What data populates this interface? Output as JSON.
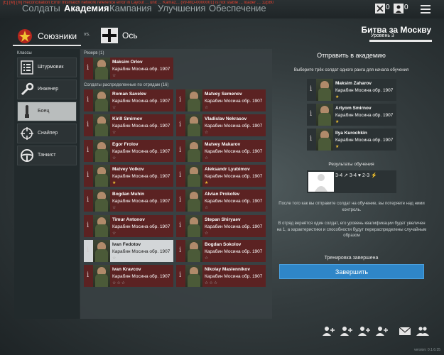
{
  "top_nav": {
    "tabs": [
      {
        "label": "Солдаты"
      },
      {
        "label": "Академия"
      },
      {
        "label": "Кампания"
      },
      {
        "label": "Улучшения"
      },
      {
        "label": "Обеспечение"
      }
    ],
    "debug_text": "[E] [M] [m] Reconciliation Error mismatch network reference error in Layout ... unit ... Kamaz... (v9-MD-0000001) is not stable ... loader ... 12p80",
    "counters": {
      "first": "0",
      "second": "0"
    }
  },
  "sides": {
    "allies": "Союзники",
    "vs": "vs.",
    "axis": "Ось"
  },
  "mission": {
    "title": "Битва за Москву",
    "level": "Уровень 3"
  },
  "classes": {
    "title": "Классы",
    "items": [
      {
        "label": "Штурмовик",
        "icon": "list-icon"
      },
      {
        "label": "Инженер",
        "icon": "wrench-icon"
      },
      {
        "label": "Боец",
        "icon": "bullet-icon"
      },
      {
        "label": "Снайпер",
        "icon": "crosshair-icon"
      },
      {
        "label": "Танкист",
        "icon": "steering-wheel-icon"
      }
    ]
  },
  "reserve": {
    "title": "Резерв (1)",
    "soldiers": [
      {
        "name": "Maksim Orlov",
        "weapon": "Карабин Мосина обр. 1907",
        "stars": "☆"
      }
    ]
  },
  "squads": {
    "title": "Солдаты распределенные по отрядам (16)",
    "soldiers": [
      {
        "name": "Roman Savelev",
        "weapon": "Карабин Мосина обр. 1907",
        "stars": "☆"
      },
      {
        "name": "Matvey Semenov",
        "weapon": "Карабин Мосина обр. 1907",
        "stars": "☆"
      },
      {
        "name": "Kirill Smirnov",
        "weapon": "Карабин Мосина обр. 1907",
        "stars": "☆"
      },
      {
        "name": "Vladislav Nekrasov",
        "weapon": "Карабин Мосина обр. 1907",
        "stars": "☆"
      },
      {
        "name": "Egor Frolov",
        "weapon": "Карабин Мосина обр. 1907",
        "stars": "☆"
      },
      {
        "name": "Matvey Makarov",
        "weapon": "Карабин Мосина обр. 1907",
        "stars": "☆"
      },
      {
        "name": "Matvey Volkov",
        "weapon": "Карабин Мосина обр. 1907",
        "stars": "★"
      },
      {
        "name": "Aleksandr Lyubimov",
        "weapon": "Карабин Мосина обр. 1907",
        "stars": "★"
      },
      {
        "name": "Bogdan Muhin",
        "weapon": "Карабин Мосина обр. 1907",
        "stars": "☆"
      },
      {
        "name": "Alvian Prokofev",
        "weapon": "Карабин Мосина обр. 1907",
        "stars": "☆"
      },
      {
        "name": "Timur Antonov",
        "weapon": "Карабин Мосина обр. 1907",
        "stars": "☆"
      },
      {
        "name": "Stepan Shiryaev",
        "weapon": "Карабин Мосина обр. 1907",
        "stars": "☆"
      },
      {
        "name": "Ivan Fedotov",
        "weapon": "Карабин Мосина обр. 1907",
        "stars": "☆"
      },
      {
        "name": "Bogdan Sokolov",
        "weapon": "Карабин Мосина обр. 1907",
        "stars": "☆"
      },
      {
        "name": "Ivan Kravcov",
        "weapon": "Карабин Мосина обр. 1907",
        "stars": "☆☆☆"
      },
      {
        "name": "Nikolay Maslennikov",
        "weapon": "Карабин Мосина обр. 1907",
        "stars": "☆☆☆"
      }
    ]
  },
  "academy": {
    "title": "Отправить в академию",
    "subtitle": "Выберите трёх солдат одного ранга для начала обучения",
    "selected": [
      {
        "name": "Maksim Zaharov",
        "weapon": "Карабин Мосина обр. 1907",
        "stars": "★"
      },
      {
        "name": "Artyom Smirnov",
        "weapon": "Карабин Мосина обр. 1907",
        "stars": "★"
      },
      {
        "name": "Ilya Kurochkin",
        "weapon": "Карабин Мосина обр. 1907",
        "stars": "★"
      }
    ],
    "results_title": "Результаты обучения",
    "results_stats": "3-4 ↗ 3-4 ♥ 2-3 ⚡",
    "note1": "После того как вы отправите солдат на обучение, вы потеряете над ними контроль.",
    "note2": "В отряд вернётся один солдат, его уровень квалификации будет увеличен на 1, а характеристики и способности будут перераспределены случайным образом",
    "training_status": "Тренировка завершена",
    "finish_label": "Завершить"
  },
  "version": "version: 0.1.6.35",
  "colors": {
    "card_bg": "#5b2222",
    "accent_blue": "#2f86c8",
    "star_gold": "#f1c232"
  }
}
